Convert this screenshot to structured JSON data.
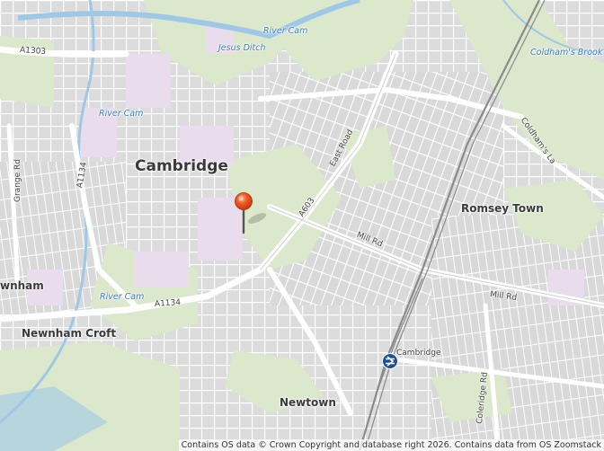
{
  "map": {
    "places": [
      {
        "id": "cambridge",
        "text": "Cambridge"
      },
      {
        "id": "romsey-town",
        "text": "Romsey Town"
      },
      {
        "id": "newnham-croft",
        "text": "Newnham Croft"
      },
      {
        "id": "newnham",
        "text": "wnham"
      },
      {
        "id": "newtown",
        "text": "Newtown"
      }
    ],
    "roads": [
      {
        "id": "a1303",
        "text": "A1303"
      },
      {
        "id": "grange-rd",
        "text": "Grange Rd"
      },
      {
        "id": "a1134-north",
        "text": "A1134"
      },
      {
        "id": "a1134-south",
        "text": "A1134"
      },
      {
        "id": "east-road",
        "text": "East Road"
      },
      {
        "id": "a603",
        "text": "A603"
      },
      {
        "id": "mill-rd-west",
        "text": "Mill Rd"
      },
      {
        "id": "mill-rd-east",
        "text": "Mill Rd"
      },
      {
        "id": "coldhams-la",
        "text": "Coldham's La"
      },
      {
        "id": "coleridge-rd",
        "text": "Coleridge Rd"
      },
      {
        "id": "cambridge-station",
        "text": "Cambridge"
      }
    ],
    "water": [
      {
        "id": "river-cam-north",
        "text": "River Cam"
      },
      {
        "id": "river-cam-west",
        "text": "River Cam"
      },
      {
        "id": "river-cam-south",
        "text": "River Cam"
      },
      {
        "id": "jesus-ditch",
        "text": "Jesus Ditch"
      },
      {
        "id": "coldhams-brook",
        "text": "Coldham's Brook"
      }
    ],
    "attribution": "Contains OS data © Crown Copyright and database right 2026. Contains data from OS Zoomstack",
    "icons": {
      "marker": "map-pin-icon",
      "station": "railway-station-icon"
    },
    "colors": {
      "background": "#ececec",
      "green": "#dce8cc",
      "road": "#ffffff",
      "water": "#9fc8e6",
      "university": "#e9dcec",
      "marker": "#e8481f"
    }
  }
}
